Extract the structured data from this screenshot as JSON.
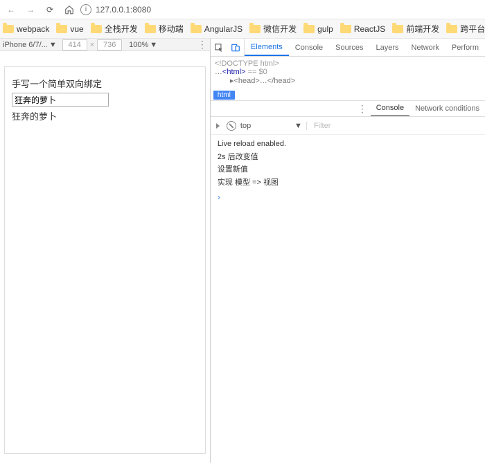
{
  "toolbar": {
    "url": "127.0.0.1:8080"
  },
  "bookmarks": [
    "webpack",
    "vue",
    "全栈开发",
    "移动端",
    "AngularJS",
    "微信开发",
    "gulp",
    "ReactJS",
    "前端开发",
    "跨平台开发平台"
  ],
  "device": {
    "name": "iPhone 6/7/...",
    "w": "414",
    "h": "736",
    "zoom": "100%"
  },
  "page": {
    "title": "手写一个简单双向绑定",
    "value": "狂奔的萝卜",
    "echo": "狂奔的萝卜"
  },
  "devtools": {
    "tabs": [
      "Elements",
      "Console",
      "Sources",
      "Layers",
      "Network",
      "Perform"
    ],
    "active": "Elements",
    "dom": {
      "doctype": "<!DOCTYPE html>",
      "line": "<html>",
      "eq": " == $0",
      "head": "▸<head>…</head>"
    },
    "crumb": "html",
    "drawer": {
      "tabs": [
        "Console",
        "Network conditions"
      ],
      "active": "Console"
    },
    "console": {
      "context": "top",
      "filter": "Filter",
      "logs": [
        "Live reload enabled.",
        "2s 后改变值",
        "设置新值",
        "实现 模型 => 视图"
      ]
    }
  }
}
